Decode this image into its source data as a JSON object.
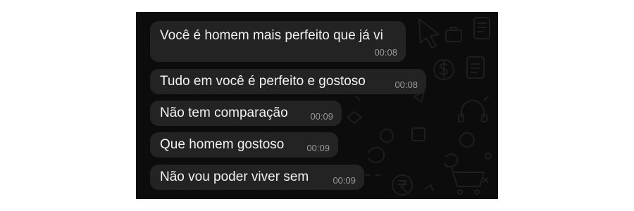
{
  "messages": [
    {
      "text": "Você é homem mais perfeito que já vi",
      "time": "00:08"
    },
    {
      "text": "Tudo em você é perfeito e gostoso",
      "time": "00:08"
    },
    {
      "text": "Não tem comparação",
      "time": "00:09"
    },
    {
      "text": "Que homem gostoso",
      "time": "00:09"
    },
    {
      "text": "Não vou poder viver sem",
      "time": "00:09"
    }
  ],
  "colors": {
    "background": "#0c0c0c",
    "bubble": "#232323",
    "text": "#f2f2f2",
    "timestamp": "#9a9a9a"
  }
}
